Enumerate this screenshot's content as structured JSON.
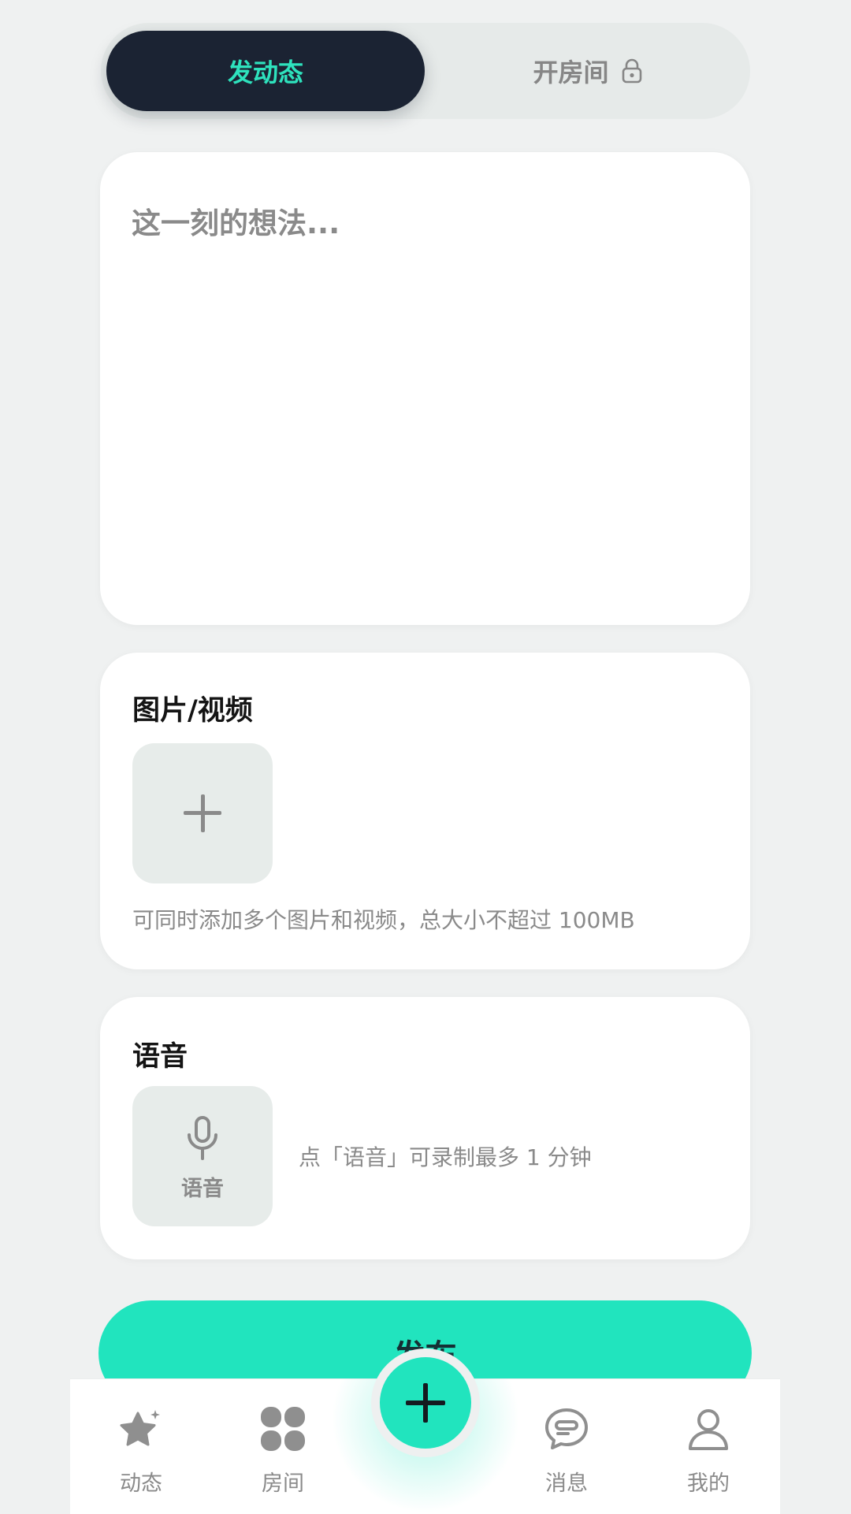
{
  "mode_switch": {
    "post_label": "发动态",
    "room_label": "开房间",
    "room_icon": "lock-icon",
    "active": "post"
  },
  "post_input": {
    "placeholder": "这一刻的想法...",
    "value": ""
  },
  "media_section": {
    "title": "图片/视频",
    "add_icon": "plus-icon",
    "hint": "可同时添加多个图片和视频，总大小不超过 100MB"
  },
  "voice_section": {
    "title": "语音",
    "record_label": "语音",
    "record_icon": "microphone-icon",
    "hint": "点「语音」可录制最多 1 分钟"
  },
  "publish_button": {
    "label": "发布"
  },
  "tab_bar": {
    "items": [
      {
        "label": "动态",
        "icon": "star-icon"
      },
      {
        "label": "房间",
        "icon": "clover-icon"
      },
      {
        "label": "",
        "icon": "plus-icon"
      },
      {
        "label": "消息",
        "icon": "chat-bubble-icon"
      },
      {
        "label": "我的",
        "icon": "person-icon"
      }
    ]
  },
  "colors": {
    "accent": "#21e4be",
    "dark": "#1b2333",
    "background": "#eff1f1",
    "muted_text": "#8a8a8a"
  }
}
